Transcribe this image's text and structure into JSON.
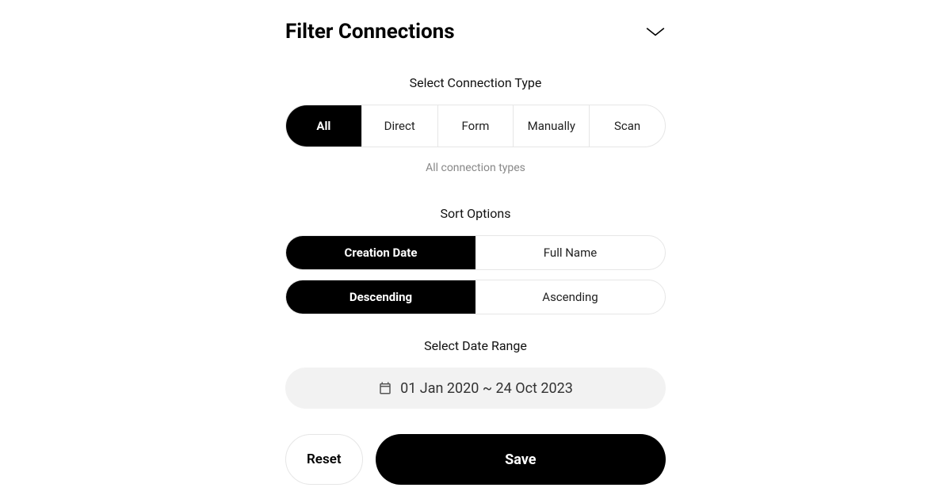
{
  "header": {
    "title": "Filter Connections"
  },
  "connectionType": {
    "label": "Select Connection Type",
    "hint": "All connection types",
    "options": [
      "All",
      "Direct",
      "Form",
      "Manually",
      "Scan"
    ],
    "activeIndex": 0
  },
  "sortOptions": {
    "label": "Sort Options",
    "field": {
      "options": [
        "Creation Date",
        "Full Name"
      ],
      "activeIndex": 0
    },
    "direction": {
      "options": [
        "Descending",
        "Ascending"
      ],
      "activeIndex": 0
    }
  },
  "dateRange": {
    "label": "Select Date Range",
    "value": "01 Jan 2020 ~ 24 Oct 2023"
  },
  "footer": {
    "reset": "Reset",
    "save": "Save"
  }
}
